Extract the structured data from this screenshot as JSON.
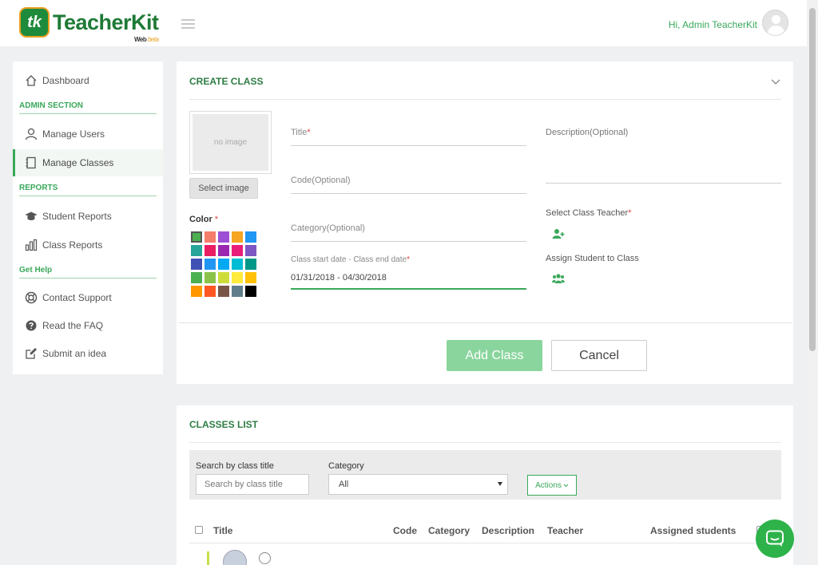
{
  "header": {
    "logo_mark": "tk",
    "logo_text": "TeacherKit",
    "logo_sub_web": "Web",
    "logo_sub_beta": "beta",
    "greeting": "Hi, Admin TeacherKit"
  },
  "sidebar": {
    "dashboard": "Dashboard",
    "admin_section": "ADMIN SECTION",
    "manage_users": "Manage Users",
    "manage_classes": "Manage Classes",
    "reports": "REPORTS",
    "student_reports": "Student Reports",
    "class_reports": "Class Reports",
    "get_help": "Get Help",
    "contact_support": "Contact Support",
    "read_faq": "Read the FAQ",
    "submit_idea": "Submit an idea"
  },
  "create_class": {
    "title": "CREATE CLASS",
    "no_image": "no image",
    "select_image": "Select image",
    "color_label": "Color",
    "required_mark": "*",
    "title_label": "Title",
    "code_label": "Code(Optional)",
    "category_label": "Category(Optional)",
    "date_label": "Class start date - Class end date",
    "date_value": "01/31/2018 - 04/30/2018",
    "description_label": "Description(Optional)",
    "select_teacher": "Select Class Teacher",
    "assign_student": "Assign Student to Class",
    "add_button": "Add Class",
    "cancel_button": "Cancel",
    "colors": [
      "#4caf50",
      "#f47c6a",
      "#9c4fd4",
      "#f5a623",
      "#2196f3",
      "#26a69a",
      "#e91e63",
      "#9c27b0",
      "#e91e7a",
      "#7e57c2",
      "#3f51b5",
      "#2196f3",
      "#03a9f4",
      "#00bcd4",
      "#009688",
      "#4caf50",
      "#8bc34a",
      "#cddc39",
      "#ffeb3b",
      "#ffc107",
      "#ff9800",
      "#ff5722",
      "#795548",
      "#607d8b",
      "#000000"
    ],
    "selected_color": "#4caf50"
  },
  "classes_list": {
    "title": "CLASSES LIST",
    "search_label": "Search by class title",
    "search_placeholder": "Search by class title",
    "category_label": "Category",
    "category_value": "All",
    "actions_button": "Actions",
    "columns": [
      "Title",
      "Code",
      "Category",
      "Description",
      "Teacher",
      "Assigned students"
    ]
  },
  "colors": {
    "accent": "#3aa85a",
    "add_button": "#8ad59d",
    "chat_button": "#2db34a"
  }
}
